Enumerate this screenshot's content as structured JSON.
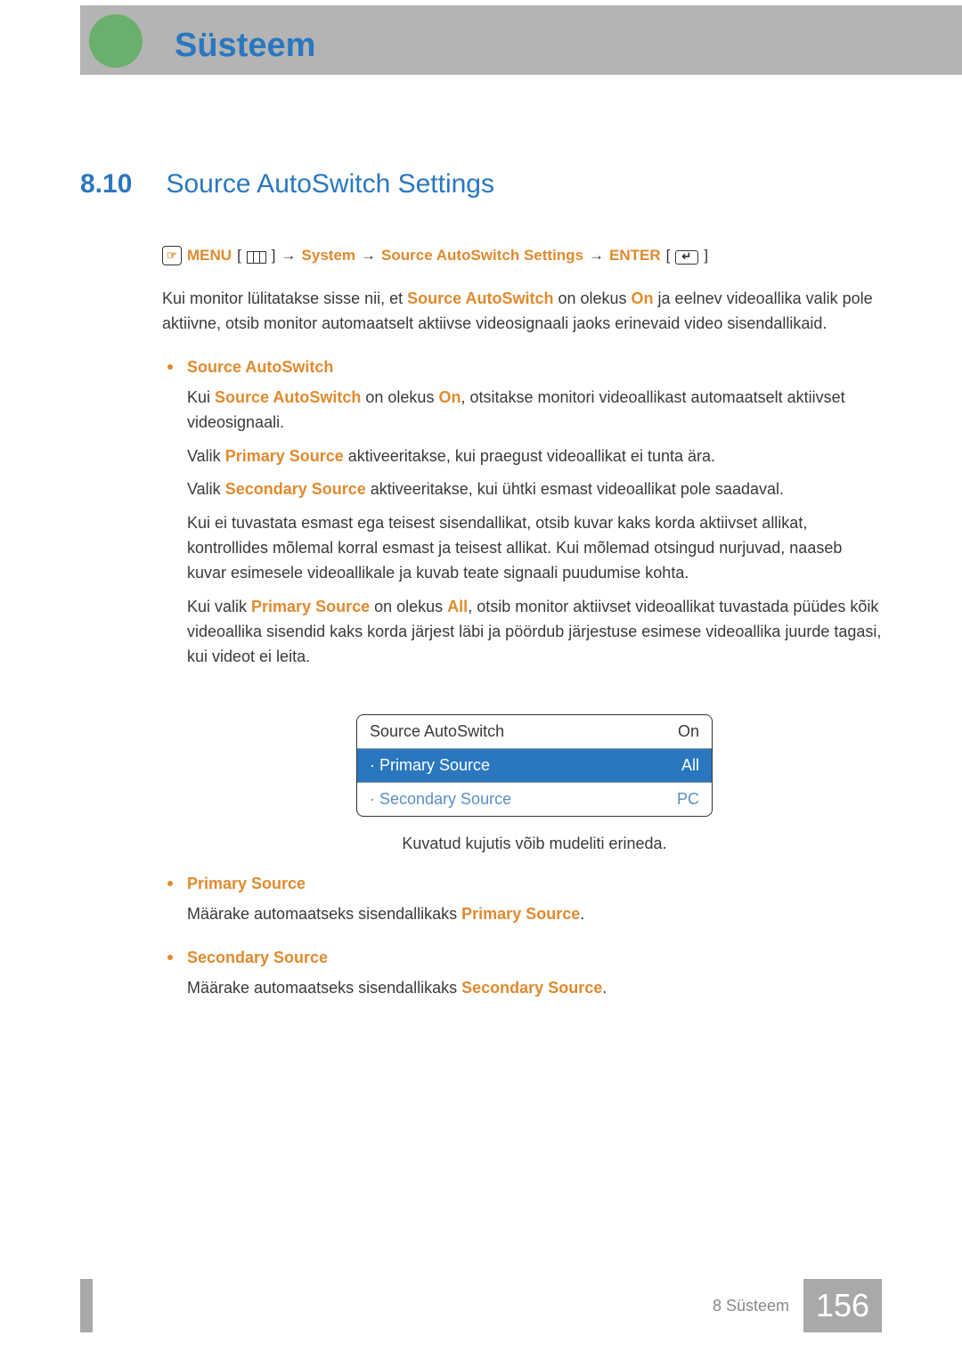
{
  "header": {
    "chapter_title": "Süsteem"
  },
  "section": {
    "number": "8.10",
    "title": "Source AutoSwitch Settings"
  },
  "nav": {
    "menu": "MENU",
    "arrow": "→",
    "system": "System",
    "source_autoswitch": "Source AutoSwitch Settings",
    "enter": "ENTER",
    "lbracket": "[",
    "rbracket": "]"
  },
  "intro": {
    "t1": "Kui monitor lülitatakse sisse nii, et ",
    "b1": "Source AutoSwitch",
    "t2": " on olekus ",
    "b2": "On",
    "t3": " ja eelnev videoallika valik pole aktiivne, otsib monitor automaatselt aktiivse videosignaali jaoks erinevaid video sisendallikaid."
  },
  "bullets": {
    "sas": {
      "head": "Source AutoSwitch",
      "p1a": "Kui ",
      "p1b": "Source AutoSwitch",
      "p1c": " on olekus ",
      "p1d": "On",
      "p1e": ", otsitakse monitori videoallikast automaatselt aktiivset videosignaali.",
      "p2a": "Valik ",
      "p2b": "Primary Source",
      "p2c": " aktiveeritakse, kui praegust videoallikat ei tunta ära.",
      "p3a": "Valik ",
      "p3b": "Secondary Source",
      "p3c": " aktiveeritakse, kui ühtki esmast videoallikat pole saadaval.",
      "p4": "Kui ei tuvastata esmast ega teisest sisendallikat, otsib kuvar kaks korda aktiivset allikat, kontrollides mõlemal korral esmast ja teisest allikat. Kui mõlemad otsingud nurjuvad, naaseb kuvar esimesele videoallikale ja kuvab teate signaali puudumise kohta.",
      "p5a": "Kui valik ",
      "p5b": "Primary Source",
      "p5c": " on olekus ",
      "p5d": "All",
      "p5e": ", otsib monitor aktiivset videoallikat tuvastada püüdes kõik videoallika sisendid kaks korda järjest läbi ja pöördub järjestuse esimese videoallika juurde tagasi, kui videot ei leita."
    },
    "primary": {
      "head": "Primary Source",
      "text_a": "Määrake automaatseks sisendallikaks ",
      "text_b": "Primary Source",
      "text_c": "."
    },
    "secondary": {
      "head": "Secondary Source",
      "text_a": "Määrake automaatseks sisendallikaks ",
      "text_b": "Secondary Source",
      "text_c": "."
    }
  },
  "osd": {
    "rows": [
      {
        "label": "Source AutoSwitch",
        "value": "On"
      },
      {
        "label": "· Primary Source",
        "value": "All"
      },
      {
        "label": "· Secondary Source",
        "value": "PC"
      }
    ],
    "caption": "Kuvatud kujutis võib mudeliti erineda."
  },
  "footer": {
    "text": "8 Süsteem",
    "page": "156"
  }
}
